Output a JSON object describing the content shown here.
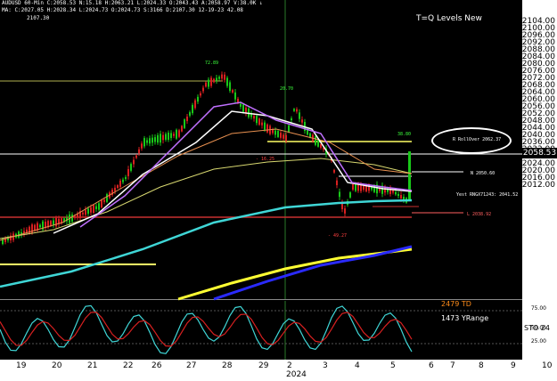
{
  "header": {
    "ticker_info": "AUDUSD 60-Min  C:2058.53  N:15.18  H:2063.21  L:2024.33  O:2043.43  A:2058.97  V:38.0K  ↓",
    "ma_info": "MA: C:2027.05  H:2028.34  L:2024.73  O:2024.73  S:3166  D:2107.30  12-19-23  42.08",
    "sub_value": "2107.30",
    "title": "T=Q Levels New"
  },
  "price_axis": {
    "ticks": [
      "2104.00",
      "2100.00",
      "2096.00",
      "2092.00",
      "2088.00",
      "2084.00",
      "2080.00",
      "2076.00",
      "2072.00",
      "2068.00",
      "2064.00",
      "2060.00",
      "2056.00",
      "2052.00",
      "2048.00",
      "2044.00",
      "2040.00",
      "2036.00",
      "2032.00",
      "2028.00",
      "2024.00",
      "2020.00",
      "2016.00",
      "2012.00"
    ],
    "current_price": "2058.53",
    "osc_ticks": [
      "75.00",
      "50.00",
      "25.00"
    ]
  },
  "date_axis": {
    "labels": [
      "19",
      "20",
      "21",
      "22",
      "26",
      "27",
      "28",
      "29",
      "2",
      "3",
      "4",
      "5",
      "6",
      "7",
      "8",
      "9",
      "10"
    ],
    "year": "2024"
  },
  "annotations": {
    "rollover": "R RollOver 2062.37",
    "high_label": "72.89",
    "mid_label": "20.70",
    "left_neg": "- 16.25",
    "right_pos": "38.80",
    "low_label": "- 49.27",
    "n_level": "N 2050.60",
    "yest_level": "Yest RNGX71243: 2041.52",
    "l_level": "L 2038.92"
  },
  "oscillator": {
    "td": "2479 TD",
    "yrange": "1473 YRange",
    "sto": "STO 24"
  },
  "colors": {
    "background": "#000000",
    "axis_bg": "#ffffff",
    "candle_up": "#19c819",
    "candle_down": "#d82020",
    "ma_cyan": "#3fd6d6",
    "ma_yellow": "#ffff33",
    "ma_blue": "#2a2aff",
    "level_yellow": "#ffff66"
  }
}
